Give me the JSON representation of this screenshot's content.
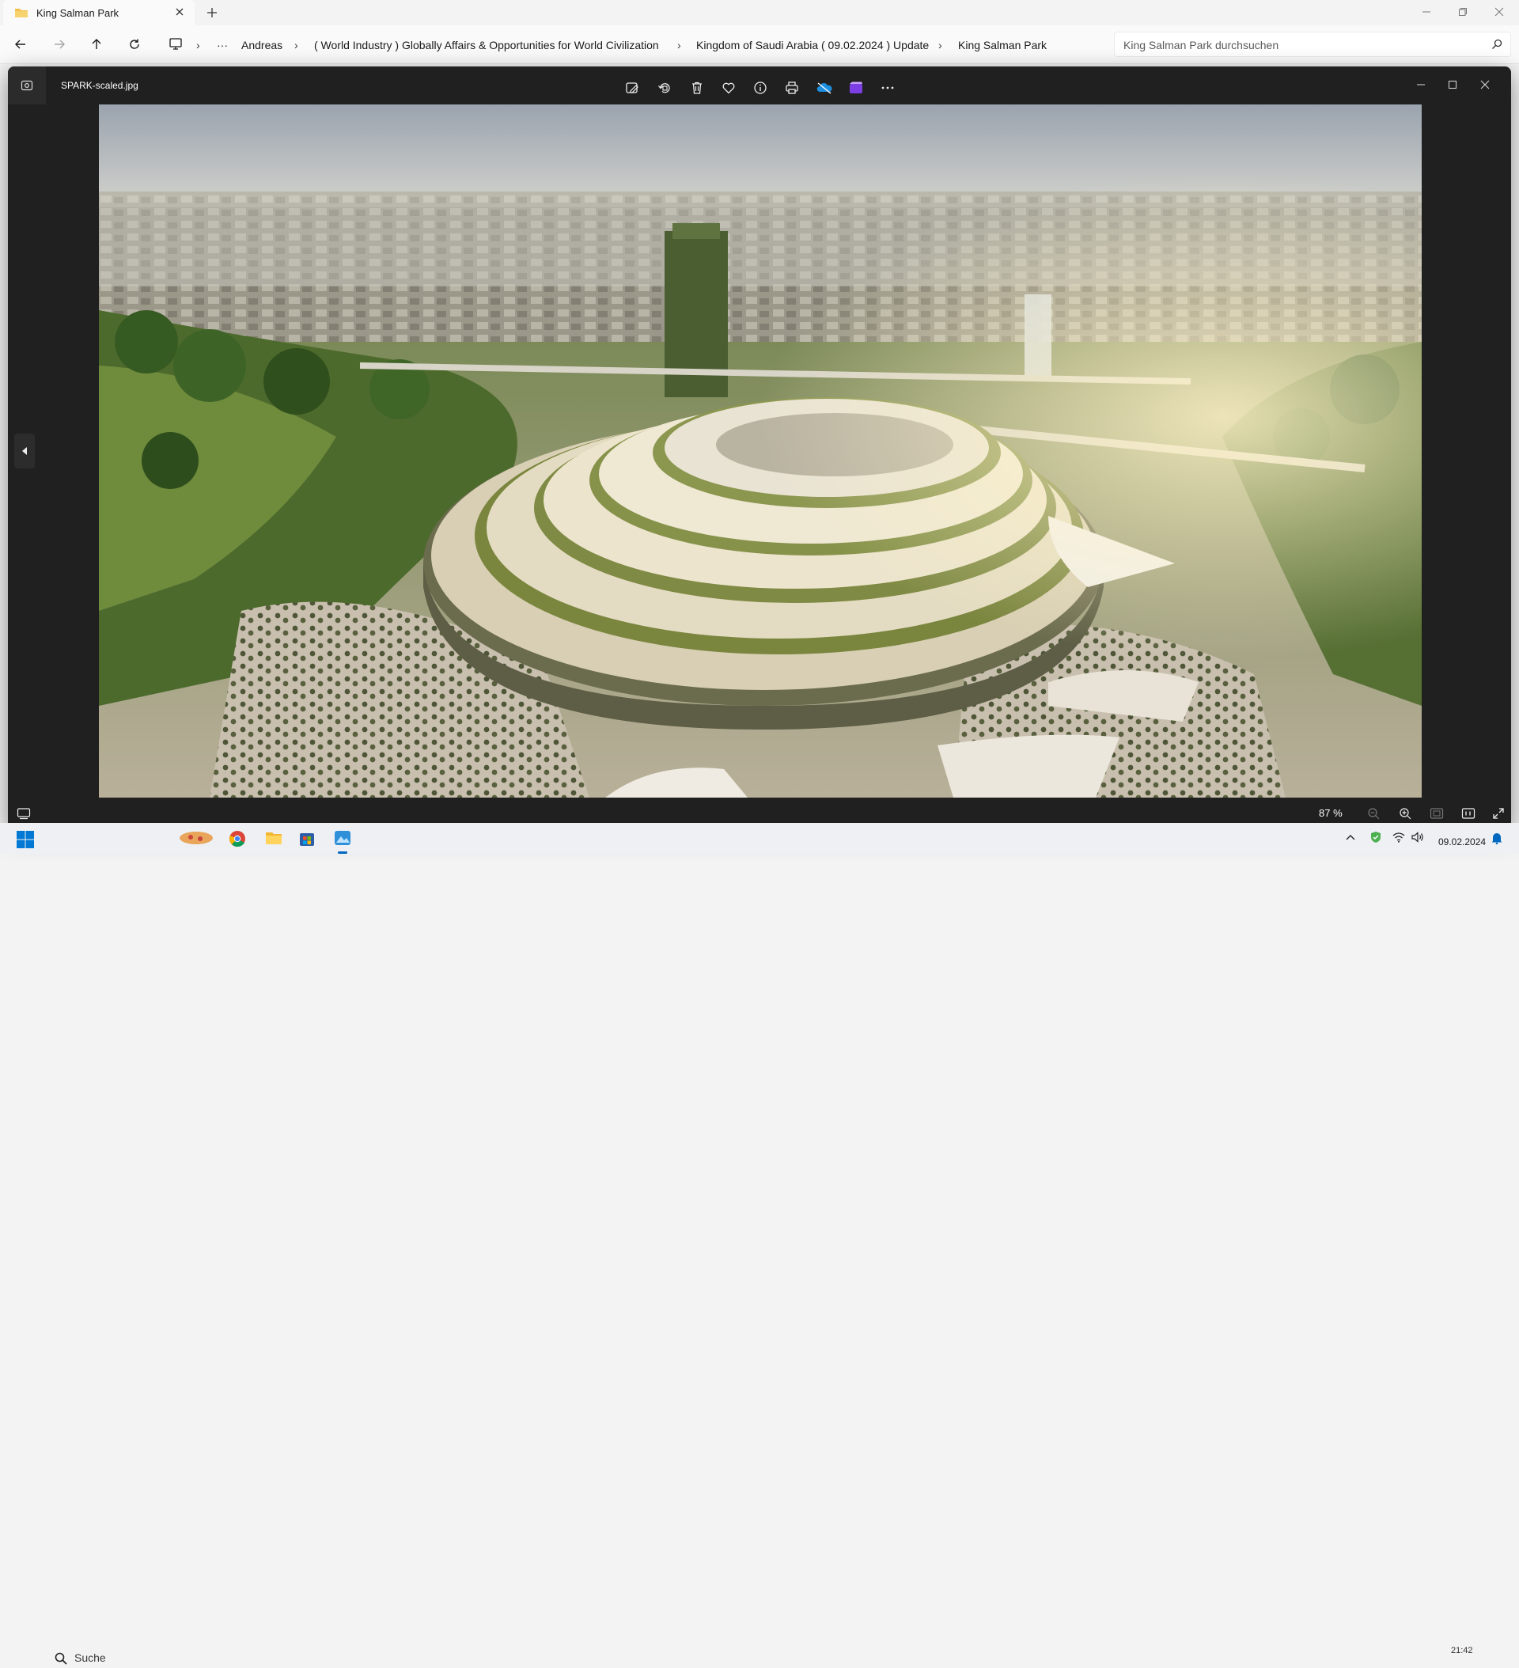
{
  "explorer": {
    "tab_title": "King Salman Park",
    "nav": {
      "back": "arrow-left-icon",
      "forward": "arrow-right-icon",
      "up": "arrow-up-icon",
      "refresh": "refresh-icon"
    },
    "breadcrumb": {
      "overflow": "···",
      "items": [
        "Andreas",
        "( World Industry ) Globally Affairs & Opportunities for World Civilization",
        "Kingdom of Saudi Arabia ( 09.02.2024 ) Update",
        "King Salman Park"
      ]
    },
    "search_placeholder": "King Salman Park durchsuchen"
  },
  "viewer": {
    "file_name": "SPARK-scaled.jpg",
    "toolbar": [
      "edit-image-icon",
      "rotate-icon",
      "delete-icon",
      "favorite-icon",
      "info-icon",
      "print-icon",
      "onedrive-icon",
      "clipchamp-icon",
      "more-icon"
    ],
    "zoom_level": "87 %",
    "photo_description": "Aerial architectural rendering of a terraced green ring building in a park with city skyline"
  },
  "taskbar": {
    "search_label": "Suche",
    "time": "21:42",
    "date": "09.02.2024"
  },
  "colors": {
    "viewer_bg": "#202020",
    "explorer_bg": "#f3f3f3",
    "taskbar_bg": "#eef0f4",
    "accent": "#0067c0"
  }
}
